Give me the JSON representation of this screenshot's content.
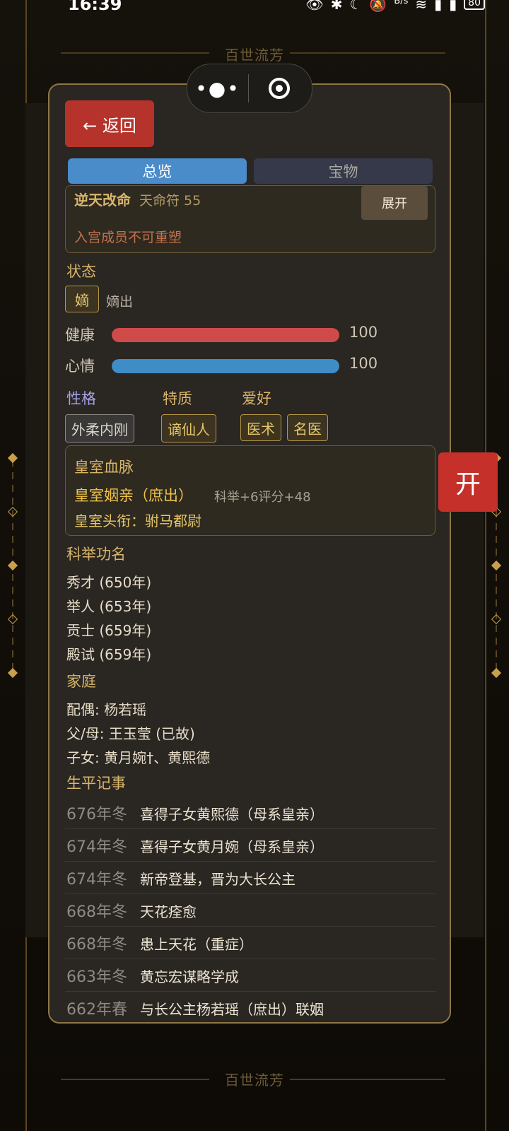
{
  "status_bar": {
    "time": "16:39",
    "net_speed": "B/s",
    "battery": "80"
  },
  "background": {
    "banner_top": "百世流芳",
    "banner_bottom": "百世流芳"
  },
  "capsule": {
    "more_icon": "more-dots-icon",
    "close_icon": "target-circle-icon"
  },
  "modal": {
    "back_label": "← 返回",
    "tabs": [
      {
        "label": "总览",
        "active": true
      },
      {
        "label": "宝物",
        "active": false
      }
    ],
    "reshape": {
      "title": "逆天改命",
      "subtitle": "天命符 55",
      "expand_label": "展开",
      "note": "入宫成员不可重塑"
    },
    "status": {
      "heading": "状态",
      "badge": "嫡",
      "badge_text": "嫡出"
    },
    "bars": [
      {
        "label": "健康",
        "value": "100",
        "color": "#cf4b49",
        "fill": 1.0
      },
      {
        "label": "心情",
        "value": "100",
        "color": "#3f8dc6",
        "fill": 1.0
      }
    ],
    "traits": {
      "personality_heading": "性格",
      "feature_heading": "特质",
      "hobby_heading": "爱好",
      "personality": "外柔内刚",
      "feature": "谪仙人",
      "hobbies": [
        "医术",
        "名医"
      ]
    },
    "royal": {
      "title": "皇室血脉",
      "relation": "皇室姻亲（庶出）",
      "bonus": "科举+6评分+48",
      "rank": "皇室头衔：驸马都尉"
    },
    "exam": {
      "heading": "科举功名",
      "items": [
        "秀才 (650年)",
        "举人 (653年)",
        "贡士 (659年)",
        "殿试 (659年)"
      ]
    },
    "family": {
      "heading": "家庭",
      "spouse": "配偶: 杨若瑶",
      "parents": "父/母: 王玉莹 (已故)",
      "children": "子女: 黄月婉†、黄熙德"
    },
    "life": {
      "heading": "生平记事",
      "events": [
        {
          "date": "676年冬",
          "text": "喜得子女黄熙德（母系皇亲）"
        },
        {
          "date": "674年冬",
          "text": "喜得子女黄月婉（母系皇亲）"
        },
        {
          "date": "674年冬",
          "text": "新帝登基，晋为大长公主"
        },
        {
          "date": "668年冬",
          "text": "天花痊愈"
        },
        {
          "date": "668年冬",
          "text": "患上天花（重症）"
        },
        {
          "date": "663年冬",
          "text": "黄忘宏谋略学成"
        },
        {
          "date": "662年春",
          "text": "与长公主杨若瑶（庶出）联姻"
        }
      ]
    }
  },
  "float_button": {
    "label": "开"
  }
}
